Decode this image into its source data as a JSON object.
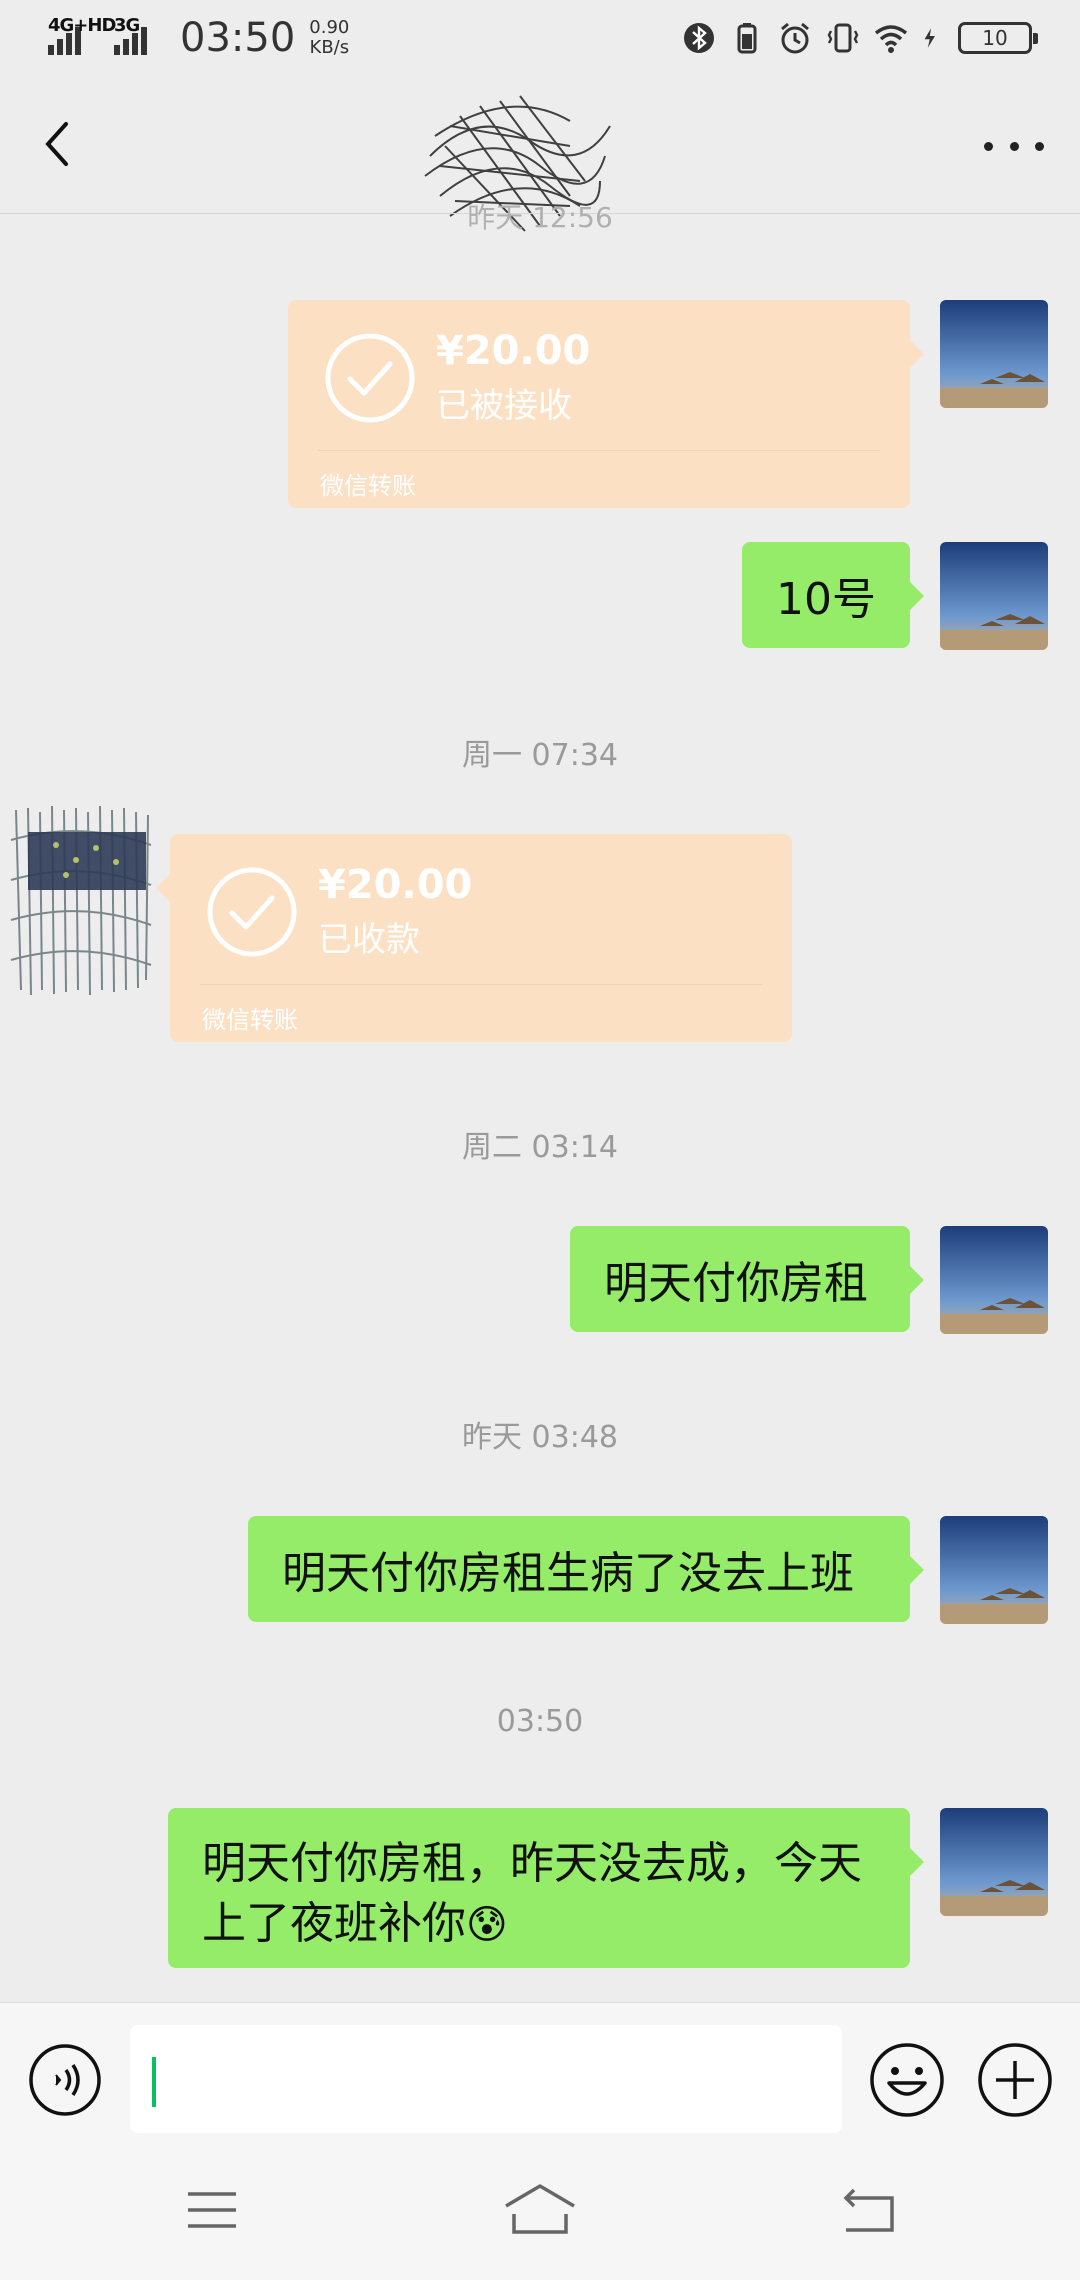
{
  "status_bar": {
    "network1": "4G+HD",
    "network2": "3G",
    "time": "03:50",
    "speed_value": "0.90",
    "speed_unit": "KB/s",
    "battery": "10",
    "icons": [
      "bluetooth-icon",
      "battery-saver-icon",
      "alarm-icon",
      "vibrate-icon",
      "wifi-icon",
      "charging-icon"
    ]
  },
  "header": {
    "title_scribbled": true,
    "cut_timestamp": "昨天 12:56"
  },
  "messages": [
    {
      "type": "transfer",
      "side": "right",
      "amount": "¥20.00",
      "status": "已被接收",
      "label": "微信转账"
    },
    {
      "type": "text",
      "side": "right",
      "text": "10号"
    },
    {
      "type": "timestamp",
      "text": "周一 07:34"
    },
    {
      "type": "transfer",
      "side": "left",
      "amount": "¥20.00",
      "status": "已收款",
      "label": "微信转账"
    },
    {
      "type": "timestamp",
      "text": "周二 03:14"
    },
    {
      "type": "text",
      "side": "right",
      "text": "明天付你房租"
    },
    {
      "type": "timestamp",
      "text": "昨天 03:48"
    },
    {
      "type": "text",
      "side": "right",
      "text": "明天付你房租生病了没去上班"
    },
    {
      "type": "timestamp",
      "text": "03:50"
    },
    {
      "type": "text",
      "side": "right",
      "line1": "明天付你房租，昨天没去成，今天",
      "line2": "上了夜班补你",
      "emoji": "😰"
    }
  ],
  "input": {
    "value": ""
  },
  "colors": {
    "background": "#ededed",
    "my_bubble": "#95ec69",
    "transfer_bubble": "#fbe0c4",
    "timestamp_text": "#9a9a9a",
    "caret": "#07c160"
  }
}
